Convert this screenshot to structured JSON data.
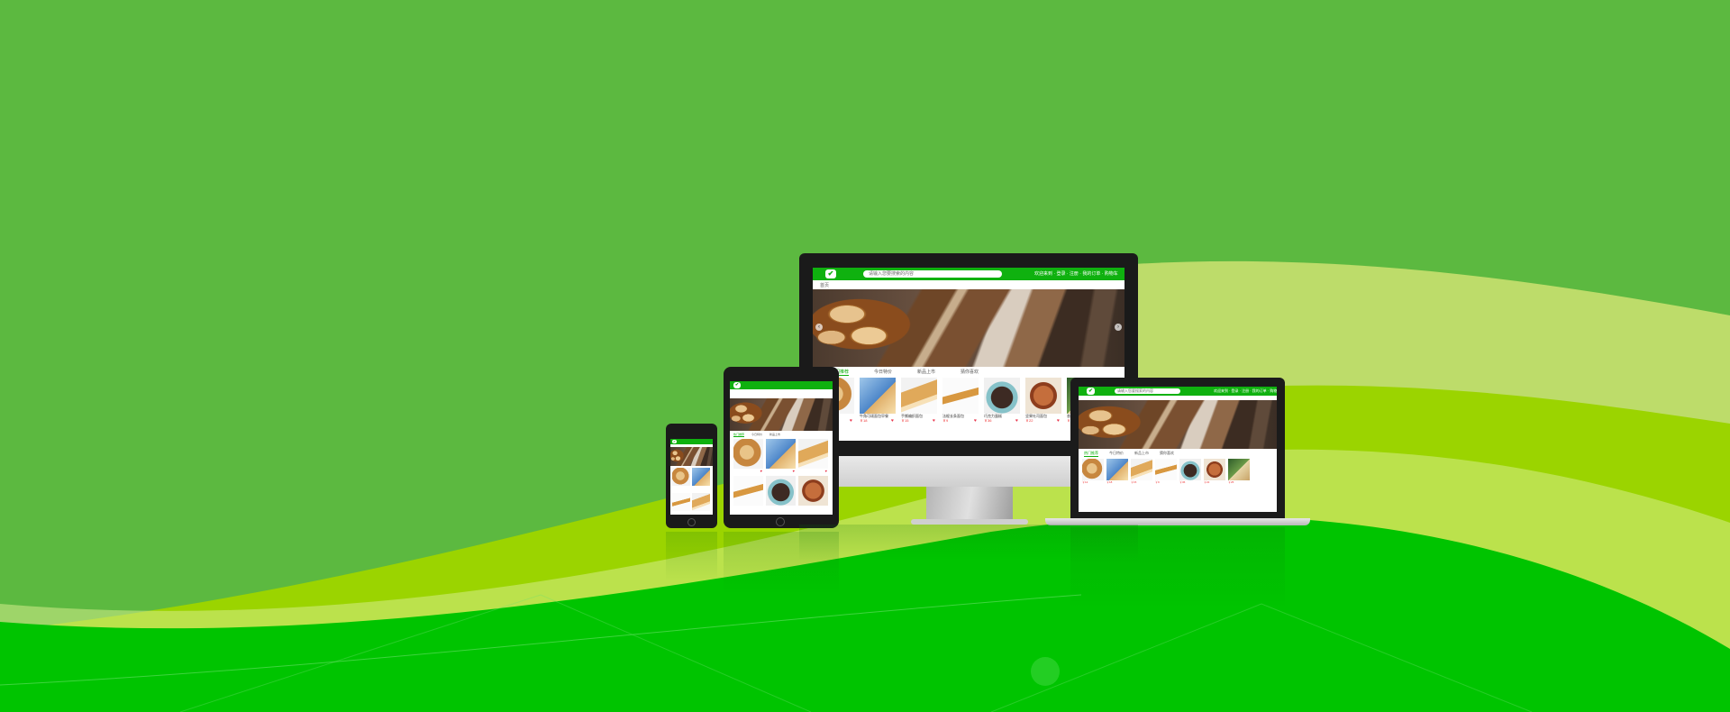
{
  "colors": {
    "background_green": "#5cb940",
    "wave_light": "#bddc6a",
    "wave_lime": "#9bd400",
    "wave_bright": "#00c400",
    "site_brand": "#0fb10f",
    "price_red": "#e33333",
    "heart_red": "#e8334a"
  },
  "site": {
    "logo_icon": "basket-logo-icon",
    "search_placeholder": "请输入您要搜索的内容",
    "user_links": "欢迎来到 · 登录 · 注册 · 我的订单 · 购物车",
    "breadcrumb": "首页",
    "tabs": [
      "热门推荐",
      "今日特价",
      "新品上市",
      "猜你喜欢"
    ],
    "products": [
      {
        "title": "法式面包",
        "price": "￥12",
        "sold": "已售 236",
        "look": "f-bun"
      },
      {
        "title": "牛角可颂面包早餐",
        "price": "￥18",
        "sold": "已售 512",
        "look": "f-blue"
      },
      {
        "title": "手撕编织面包",
        "price": "￥15",
        "sold": "已售 318",
        "look": "f-braid"
      },
      {
        "title": "法棍长条面包",
        "price": "￥9",
        "sold": "已售 887",
        "look": "f-stick"
      },
      {
        "title": "巧克力蛋糕",
        "price": "￥36",
        "sold": "已售 145",
        "look": "f-choc"
      },
      {
        "title": "坚果吐司面包",
        "price": "￥22",
        "sold": "已售 264",
        "look": "f-nut"
      },
      {
        "title": "香草全麦面包",
        "price": "￥25",
        "sold": "已售 97",
        "look": "f-herb"
      }
    ]
  }
}
